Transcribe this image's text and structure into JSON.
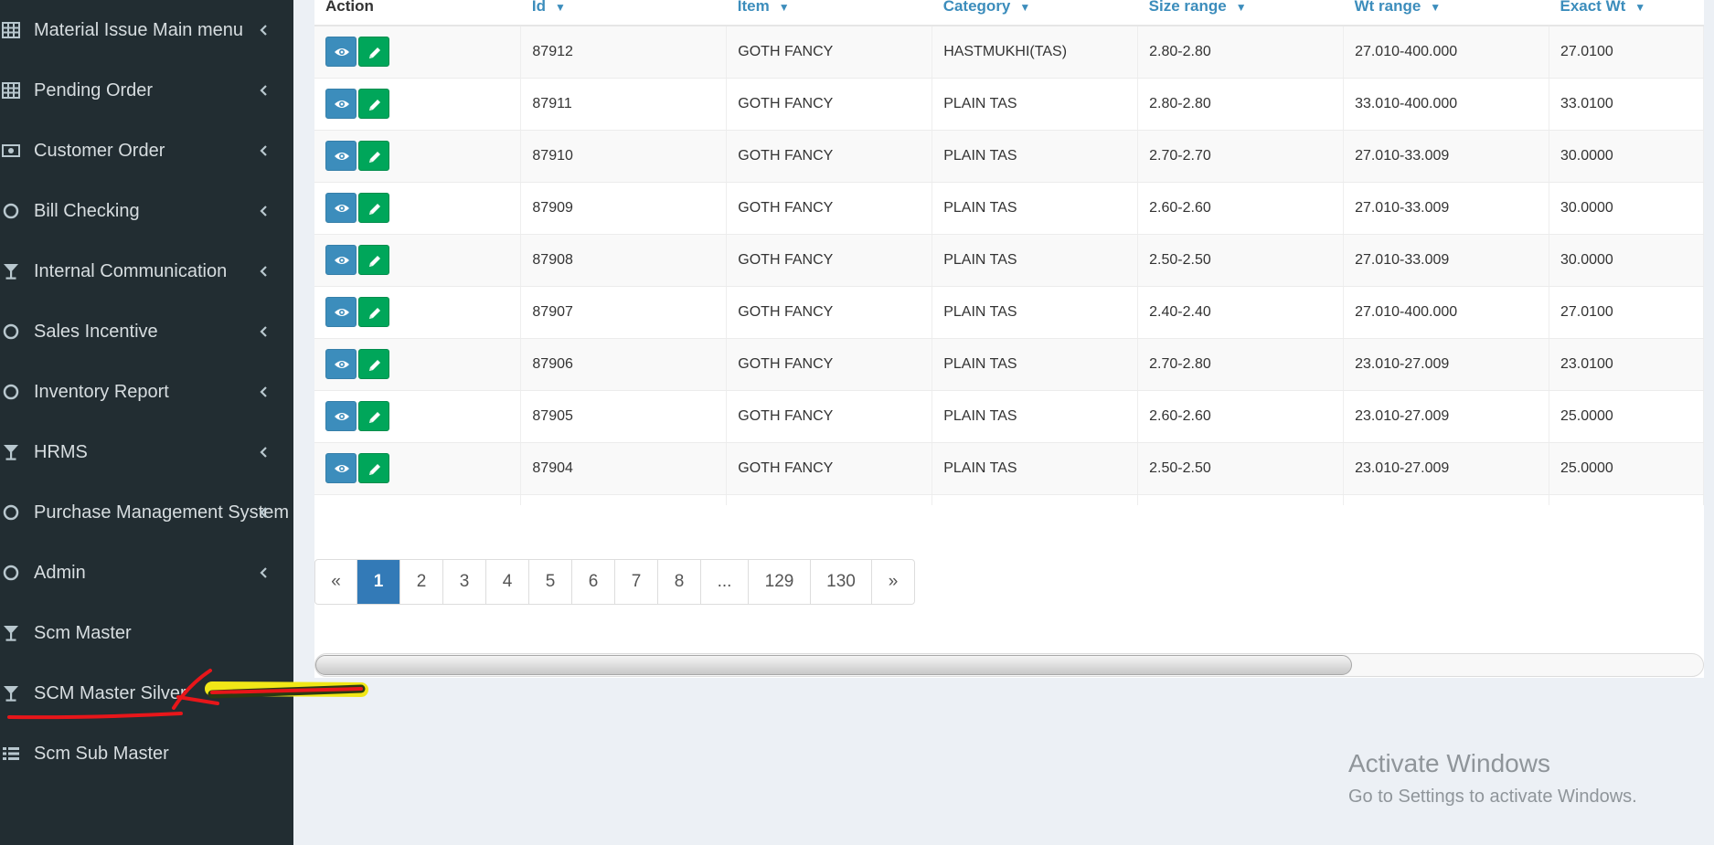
{
  "sidebar": {
    "items": [
      {
        "label": "Material Issue Main menu",
        "icon": "table-icon",
        "has_chevron": true
      },
      {
        "label": "Pending Order",
        "icon": "table-icon",
        "has_chevron": true
      },
      {
        "label": "Customer Order",
        "icon": "money-icon",
        "has_chevron": true
      },
      {
        "label": "Bill Checking",
        "icon": "circle-icon",
        "has_chevron": true
      },
      {
        "label": "Internal Communication",
        "icon": "glass-icon",
        "has_chevron": true
      },
      {
        "label": "Sales Incentive",
        "icon": "circle-icon",
        "has_chevron": true
      },
      {
        "label": "Inventory Report",
        "icon": "circle-icon",
        "has_chevron": true
      },
      {
        "label": "HRMS",
        "icon": "glass-icon",
        "has_chevron": true
      },
      {
        "label": "Purchase Management System",
        "icon": "circle-icon",
        "has_chevron": true
      },
      {
        "label": "Admin",
        "icon": "circle-icon",
        "has_chevron": true
      },
      {
        "label": "Scm Master",
        "icon": "glass-icon",
        "has_chevron": false
      },
      {
        "label": "SCM Master Silver",
        "icon": "glass-icon",
        "has_chevron": false
      },
      {
        "label": "Scm Sub Master",
        "icon": "list-icon",
        "has_chevron": false
      }
    ]
  },
  "table": {
    "headers": [
      "Action",
      "Id",
      "Item",
      "Category",
      "Size range",
      "Wt range",
      "Exact Wt"
    ],
    "rows": [
      [
        "87912",
        "GOTH FANCY",
        "HASTMUKHI(TAS)",
        "2.80-2.80",
        "27.010-400.000",
        "27.0100"
      ],
      [
        "87911",
        "GOTH FANCY",
        "PLAIN TAS",
        "2.80-2.80",
        "33.010-400.000",
        "33.0100"
      ],
      [
        "87910",
        "GOTH FANCY",
        "PLAIN TAS",
        "2.70-2.70",
        "27.010-33.009",
        "30.0000"
      ],
      [
        "87909",
        "GOTH FANCY",
        "PLAIN TAS",
        "2.60-2.60",
        "27.010-33.009",
        "30.0000"
      ],
      [
        "87908",
        "GOTH FANCY",
        "PLAIN TAS",
        "2.50-2.50",
        "27.010-33.009",
        "30.0000"
      ],
      [
        "87907",
        "GOTH FANCY",
        "PLAIN TAS",
        "2.40-2.40",
        "27.010-400.000",
        "27.0100"
      ],
      [
        "87906",
        "GOTH FANCY",
        "PLAIN TAS",
        "2.70-2.80",
        "23.010-27.009",
        "23.0100"
      ],
      [
        "87905",
        "GOTH FANCY",
        "PLAIN TAS",
        "2.60-2.60",
        "23.010-27.009",
        "25.0000"
      ],
      [
        "87904",
        "GOTH FANCY",
        "PLAIN TAS",
        "2.50-2.50",
        "23.010-27.009",
        "25.0000"
      ]
    ]
  },
  "pagination": {
    "pages": [
      "«",
      "1",
      "2",
      "3",
      "4",
      "5",
      "6",
      "7",
      "8",
      "...",
      "129",
      "130",
      "»"
    ],
    "active": "1"
  },
  "watermark": {
    "title": "Activate Windows",
    "subtitle": "Go to Settings to activate Windows."
  },
  "colors": {
    "sidebar_bg": "#222d32",
    "link_blue": "#3c8dbc",
    "view_button": "#3c8dbc",
    "edit_button": "#00a65a",
    "active_page": "#337ab7",
    "annotation_red": "#e8161a",
    "annotation_yellow": "#f1e717"
  }
}
